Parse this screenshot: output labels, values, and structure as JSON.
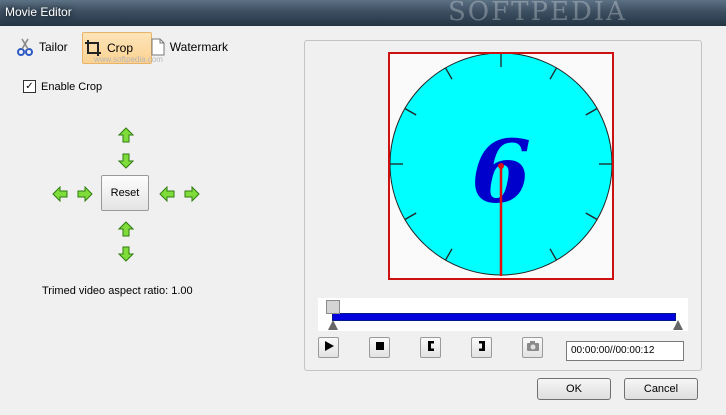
{
  "window": {
    "title": "Movie Editor",
    "watermark": "SOFTPEDIA"
  },
  "tabs": [
    {
      "label": "Tailor",
      "icon": "scissors-icon"
    },
    {
      "label": "Crop",
      "icon": "crop-icon",
      "selected": true
    },
    {
      "label": "Watermark",
      "icon": "watermark-icon"
    }
  ],
  "small_watermark": "www.softpedia.com",
  "crop": {
    "enable_label": "Enable Crop",
    "enabled": true,
    "reset_label": "Reset",
    "aspect_text": "Trimed video aspect ratio: 1.00"
  },
  "preview": {
    "frame_digit": "6",
    "border_color": "#cc1111",
    "dial_color": "#00ffff",
    "digit_color": "#0000cc"
  },
  "timeline": {
    "position": 0.0,
    "time_display": "00:00:00//00:00:12",
    "track_color": "#0000dd"
  },
  "dialog": {
    "ok_label": "OK",
    "cancel_label": "Cancel"
  }
}
